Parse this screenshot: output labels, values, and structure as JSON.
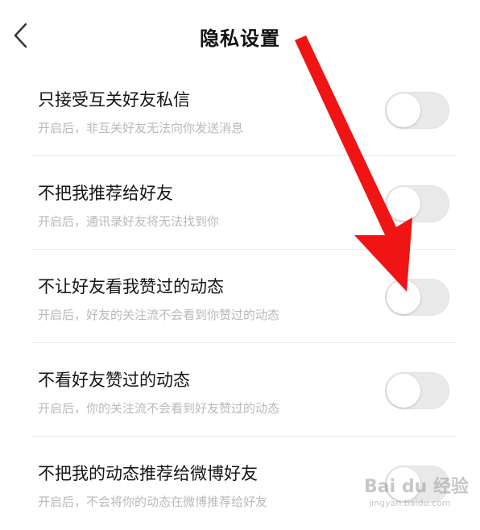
{
  "header": {
    "title": "隐私设置",
    "back_icon": "chevron-left-icon"
  },
  "settings": [
    {
      "title": "只接受互关好友私信",
      "desc": "开启后，非互关好友无法向你发送消息",
      "enabled": false
    },
    {
      "title": "不把我推荐给好友",
      "desc": "开启后，通讯录好友将无法找到你",
      "enabled": false
    },
    {
      "title": "不让好友看我赞过的动态",
      "desc": "开启后，好友的关注流不会看到你赞过的动态",
      "enabled": false
    },
    {
      "title": "不看好友赞过的动态",
      "desc": "开启后，你的关注流不会看到好友赞过的动态",
      "enabled": false
    },
    {
      "title": "不把我的动态推荐给微博好友",
      "desc": "开启后，不会将你的动态在微博推荐给好友",
      "enabled": false
    }
  ],
  "annotation": {
    "arrow_color": "#f01414"
  },
  "watermark": {
    "brand": "Bai du 经验",
    "site": "jingyan.baidu.com"
  },
  "colors": {
    "toggle_off": "#e9e9e9",
    "desc_text": "#b9b9b9",
    "title_text": "#151515"
  }
}
